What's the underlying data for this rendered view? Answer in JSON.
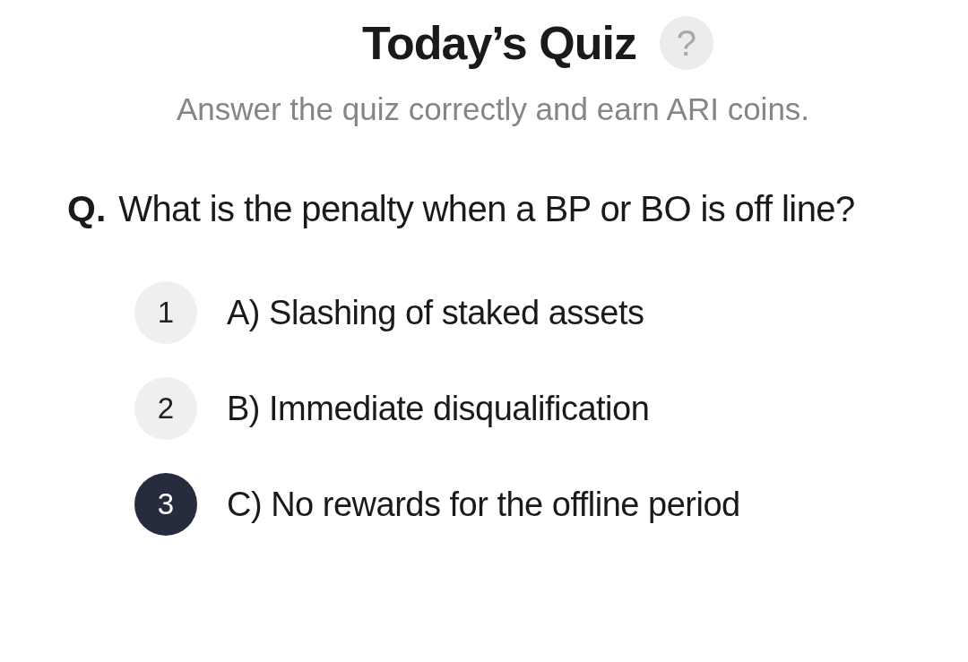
{
  "header": {
    "title": "Today’s Quiz",
    "help_icon": "?"
  },
  "subtitle": "Answer the quiz correctly and earn ARI coins.",
  "question": {
    "prefix": "Q.",
    "text": "What is the penalty when a BP or BO is off line?"
  },
  "options": [
    {
      "number": "1",
      "label": "A) Slashing of staked assets",
      "selected": false
    },
    {
      "number": "2",
      "label": "B) Immediate disqualification",
      "selected": false
    },
    {
      "number": "3",
      "label": "C) No rewards for the offline period",
      "selected": true
    }
  ]
}
